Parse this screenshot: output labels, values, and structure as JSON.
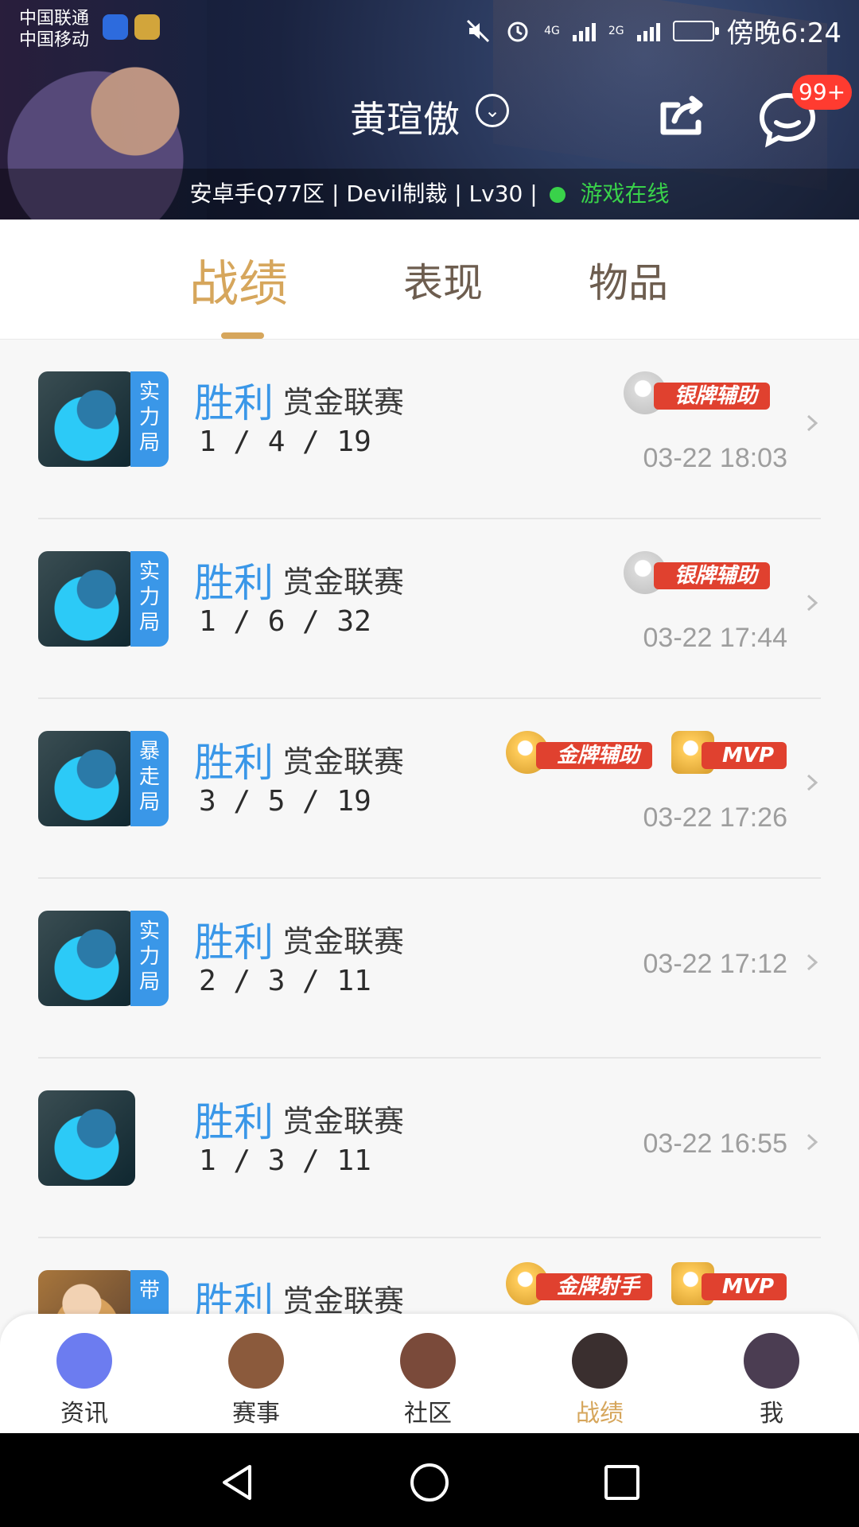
{
  "status_bar": {
    "carrier_1": "中国联通",
    "carrier_2": "中国移动",
    "net_4g": "4G",
    "net_2g": "2G",
    "time": "傍晚6:24"
  },
  "header": {
    "username": "黄瑄傲",
    "chat_badge": "99+",
    "server_info": "安卓手Q77区 | Devil制裁 | Lv30 |",
    "online_text": "游戏在线"
  },
  "tabs": [
    {
      "label": "战绩",
      "active": true
    },
    {
      "label": "表现",
      "active": false
    },
    {
      "label": "物品",
      "active": false
    }
  ],
  "matches": [
    {
      "mode_badge": "实力局",
      "result": "胜利",
      "mode": "赏金联赛",
      "kda": "1 / 4 / 19",
      "time": "03-22 18:03",
      "medals": [
        "银牌辅助"
      ]
    },
    {
      "mode_badge": "实力局",
      "result": "胜利",
      "mode": "赏金联赛",
      "kda": "1 / 6 / 32",
      "time": "03-22 17:44",
      "medals": [
        "银牌辅助"
      ]
    },
    {
      "mode_badge": "暴走局",
      "result": "胜利",
      "mode": "赏金联赛",
      "kda": "3 / 5 / 19",
      "time": "03-22 17:26",
      "medals": [
        "金牌辅助",
        "MVP"
      ]
    },
    {
      "mode_badge": "实力局",
      "result": "胜利",
      "mode": "赏金联赛",
      "kda": "2 / 3 / 11",
      "time": "03-22 17:12",
      "medals": []
    },
    {
      "mode_badge": "",
      "result": "胜利",
      "mode": "赏金联赛",
      "kda": "1 / 3 / 11",
      "time": "03-22 16:55",
      "medals": []
    },
    {
      "mode_badge": "带",
      "result": "胜利",
      "mode": "赏金联赛",
      "kda": "",
      "time": "",
      "medals": [
        "金牌射手",
        "MVP"
      ]
    }
  ],
  "bottom_nav": [
    {
      "label": "资讯",
      "active": false,
      "avatar_color": "#6c7cf0"
    },
    {
      "label": "赛事",
      "active": false,
      "avatar_color": "#8b5a3c"
    },
    {
      "label": "社区",
      "active": false,
      "avatar_color": "#7a4a3a"
    },
    {
      "label": "战绩",
      "active": true,
      "avatar_color": "#3a2f2f"
    },
    {
      "label": "我",
      "active": false,
      "avatar_color": "#4b3d52"
    }
  ],
  "colors": {
    "accent_gold": "#d6a65c",
    "win_blue": "#3a97e8",
    "online_green": "#39d24a",
    "badge_red": "#ff3b30"
  }
}
